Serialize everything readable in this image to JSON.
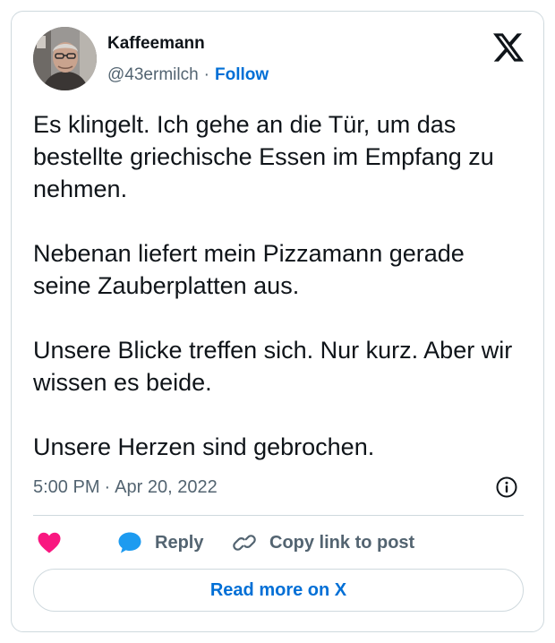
{
  "tweet": {
    "author": {
      "display_name": "Kaffeemann",
      "handle": "@43ermilch",
      "separator": "·",
      "follow_label": "Follow"
    },
    "paragraphs": [
      "Es klingelt. Ich gehe an die Tür, um das bestellte griechische Essen im Empfang zu nehmen.",
      "Nebenan liefert mein Pizzamann gerade seine Zauberplatten aus.",
      "Unsere Blicke treffen sich. Nur kurz. Aber wir wissen es beide.",
      "Unsere Herzen sind gebrochen."
    ],
    "time": "5:00 PM",
    "meta_separator": "·",
    "date": "Apr 20, 2022"
  },
  "actions": {
    "reply_label": "Reply",
    "copy_link_label": "Copy link to post"
  },
  "read_more_label": "Read more on X",
  "icons": {
    "brand": "x-logo-icon",
    "like": "heart-icon",
    "reply": "speech-bubble-icon",
    "copy_link": "link-icon",
    "info": "info-icon"
  },
  "colors": {
    "like": "#f91880",
    "reply": "#1d9bf0",
    "link_blue": "#006fd6",
    "secondary_text": "#536471",
    "border": "#cfd9de"
  }
}
